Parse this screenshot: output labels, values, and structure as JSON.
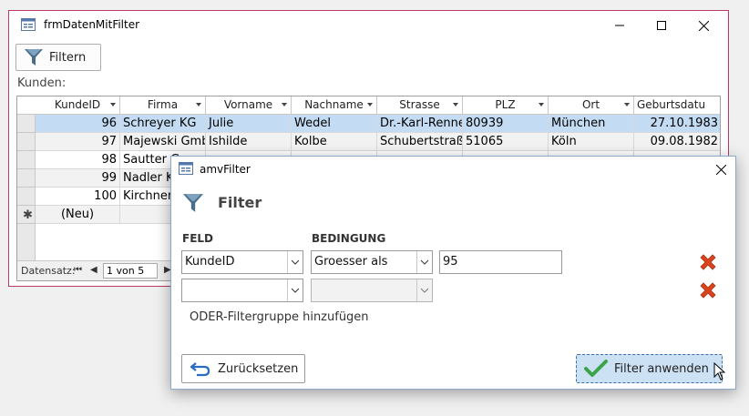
{
  "main_window": {
    "title": "frmDatenMitFilter",
    "filter_button_label": "Filtern",
    "list_label": "Kunden:"
  },
  "table": {
    "columns": [
      "KundeID",
      "Firma",
      "Vorname",
      "Nachname",
      "Strasse",
      "PLZ",
      "Ort",
      "Geburtsdatu"
    ],
    "rows": [
      [
        "96",
        "Schreyer KG",
        "Julie",
        "Wedel",
        "Dr.-Karl-Renne",
        "80939",
        "München",
        "27.10.1983"
      ],
      [
        "97",
        "Majewski Gmb",
        "Ishilde",
        "Kolbe",
        "Schubertstraße",
        "51065",
        "Köln",
        "09.08.1982"
      ],
      [
        "98",
        "Sautter G",
        "",
        "",
        "",
        "",
        "",
        ""
      ],
      [
        "99",
        "Nadler K",
        "",
        "",
        "",
        "",
        "",
        ""
      ],
      [
        "100",
        "Kirchner",
        "",
        "",
        "",
        "",
        "",
        ""
      ]
    ],
    "new_row_label": "(Neu)",
    "new_row_symbol": "✱",
    "selected_row_index": 0
  },
  "navigation": {
    "label": "Datensatz:",
    "position_text": "1 von 5",
    "first_symbol": "⏮",
    "prev_symbol": "◀",
    "next_symbol": "▶"
  },
  "dialog": {
    "title": "amvFilter",
    "heading": "Filter",
    "feld_label": "FELD",
    "bedingung_label": "BEDINGUNG",
    "rows": [
      {
        "feld": "KundeID",
        "bedingung": "Groesser als",
        "wert": "95"
      },
      {
        "feld": "",
        "bedingung": "",
        "wert": ""
      }
    ],
    "add_group_label": "ODER-Filtergruppe hinzufügen",
    "reset_label": "Zurücksetzen",
    "apply_label": "Filter anwenden"
  },
  "colors": {
    "window_border": "#b73b63",
    "selected_row": "#c3dcf3",
    "delete_icon": "#d9441c",
    "check_icon": "#3ba34a",
    "reset_icon": "#2b6cc4"
  }
}
